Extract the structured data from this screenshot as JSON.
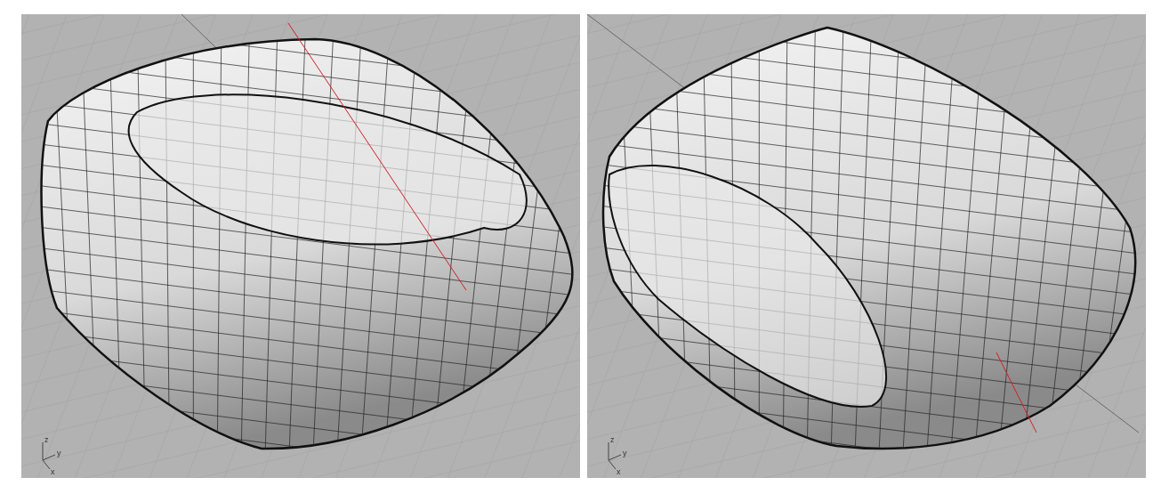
{
  "viewports": [
    {
      "axis_labels": {
        "x_label": "x",
        "y_label": "y",
        "z_label": "z"
      }
    },
    {
      "axis_labels": {
        "x_label": "x",
        "y_label": "y",
        "z_label": "z"
      }
    }
  ]
}
